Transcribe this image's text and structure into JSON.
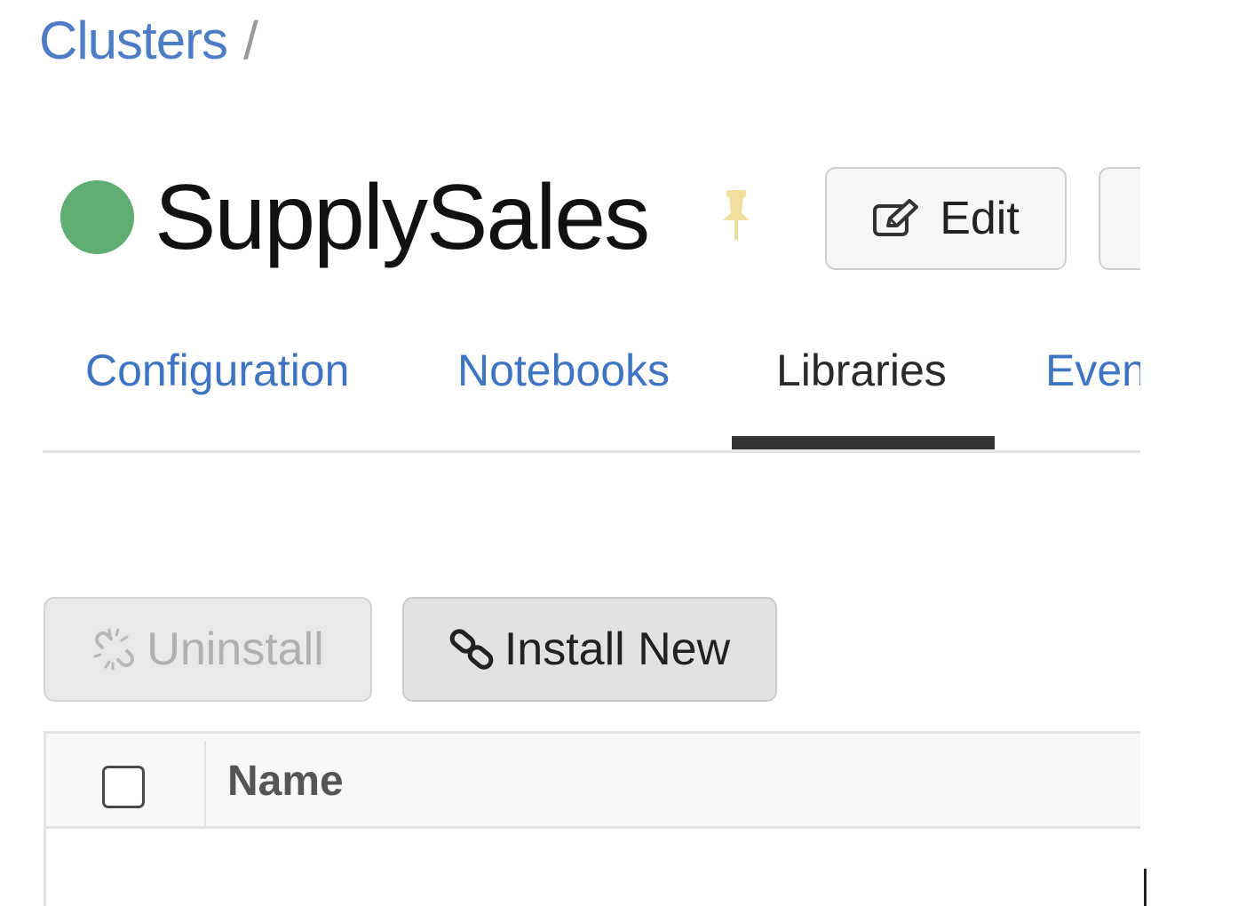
{
  "breadcrumb": {
    "parent": "Clusters",
    "separator": "/"
  },
  "cluster": {
    "name": "SupplySales",
    "status_color": "#5fad72"
  },
  "header_actions": {
    "edit_label": "Edit"
  },
  "tabs": [
    {
      "label": "Configuration",
      "active": false
    },
    {
      "label": "Notebooks",
      "active": false
    },
    {
      "label": "Libraries",
      "active": true
    },
    {
      "label": "Even",
      "active": false
    }
  ],
  "toolbar": {
    "uninstall_label": "Uninstall",
    "uninstall_disabled": true,
    "install_new_label": "Install New"
  },
  "table": {
    "columns": [
      "Name"
    ]
  },
  "colors": {
    "link": "#4d7ec5",
    "tab_link": "#3f74c3",
    "pin": "#f1dfa0"
  }
}
